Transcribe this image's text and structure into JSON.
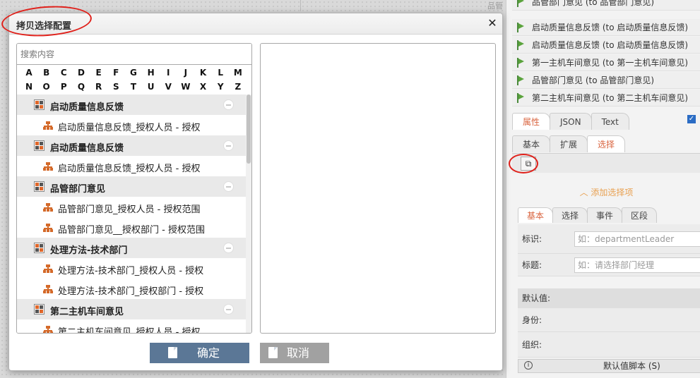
{
  "background": {
    "top_mark": "品管",
    "flow_items": [
      "品管部门意见 (to 品管部门意见)",
      "启动质量信息反馈 (to 启动质量信息反馈)",
      "启动质量信息反馈 (to 启动质量信息反馈)",
      "第一主机车间意见 (to 第一主机车间意见)",
      "品管部门意见 (to 品管部门意见)",
      "第二主机车间意见 (to 第二主机车间意见)"
    ],
    "tabs_main": [
      "属性",
      "JSON",
      "Text"
    ],
    "tabs_sub": [
      "基本",
      "扩展",
      "选择"
    ],
    "copy_icon": "copy-icon",
    "add_select": "添加选择项",
    "tabs_form": [
      "基本",
      "选择",
      "事件",
      "区段"
    ],
    "fields": {
      "id_label": "标识:",
      "id_placeholder": "如：departmentLeader",
      "title_label": "标题:",
      "title_placeholder": "如：请选择部门经理"
    },
    "default_header": "默认值:",
    "identity_label": "身份:",
    "org_label": "组织:",
    "script_bar": "默认值脚本 (S)"
  },
  "dialog": {
    "title": "拷贝选择配置",
    "close_symbol": "✕",
    "search_placeholder": "搜索内容",
    "letters_row1": [
      "A",
      "B",
      "C",
      "D",
      "E",
      "F",
      "G",
      "H",
      "I",
      "J",
      "K",
      "L",
      "M"
    ],
    "letters_row2": [
      "N",
      "O",
      "P",
      "Q",
      "R",
      "S",
      "T",
      "U",
      "V",
      "W",
      "X",
      "Y",
      "Z"
    ],
    "tree": [
      {
        "group": "启动质量信息反馈",
        "items": [
          "启动质量信息反馈_授权人员 - 授权"
        ]
      },
      {
        "group": "启动质量信息反馈",
        "items": [
          "启动质量信息反馈_授权人员 - 授权"
        ]
      },
      {
        "group": "品管部门意见",
        "items": [
          "品管部门意见_授权人员 - 授权范围",
          "品管部门意见__授权部门 - 授权范围"
        ]
      },
      {
        "group": "处理方法-技术部门",
        "items": [
          "处理方法-技术部门_授权人员 - 授权",
          "处理方法-技术部门_授权部门 - 授权"
        ]
      },
      {
        "group": "第二主机车间意见",
        "items": [
          "第二主机车间意见_授权人员 - 授权"
        ]
      }
    ],
    "ok_label": "确定",
    "cancel_label": "取消",
    "colors": {
      "ok": "#5b7796",
      "cancel": "#a1a1a1",
      "accent": "#e0672a",
      "annotation": "#e0201a"
    }
  }
}
